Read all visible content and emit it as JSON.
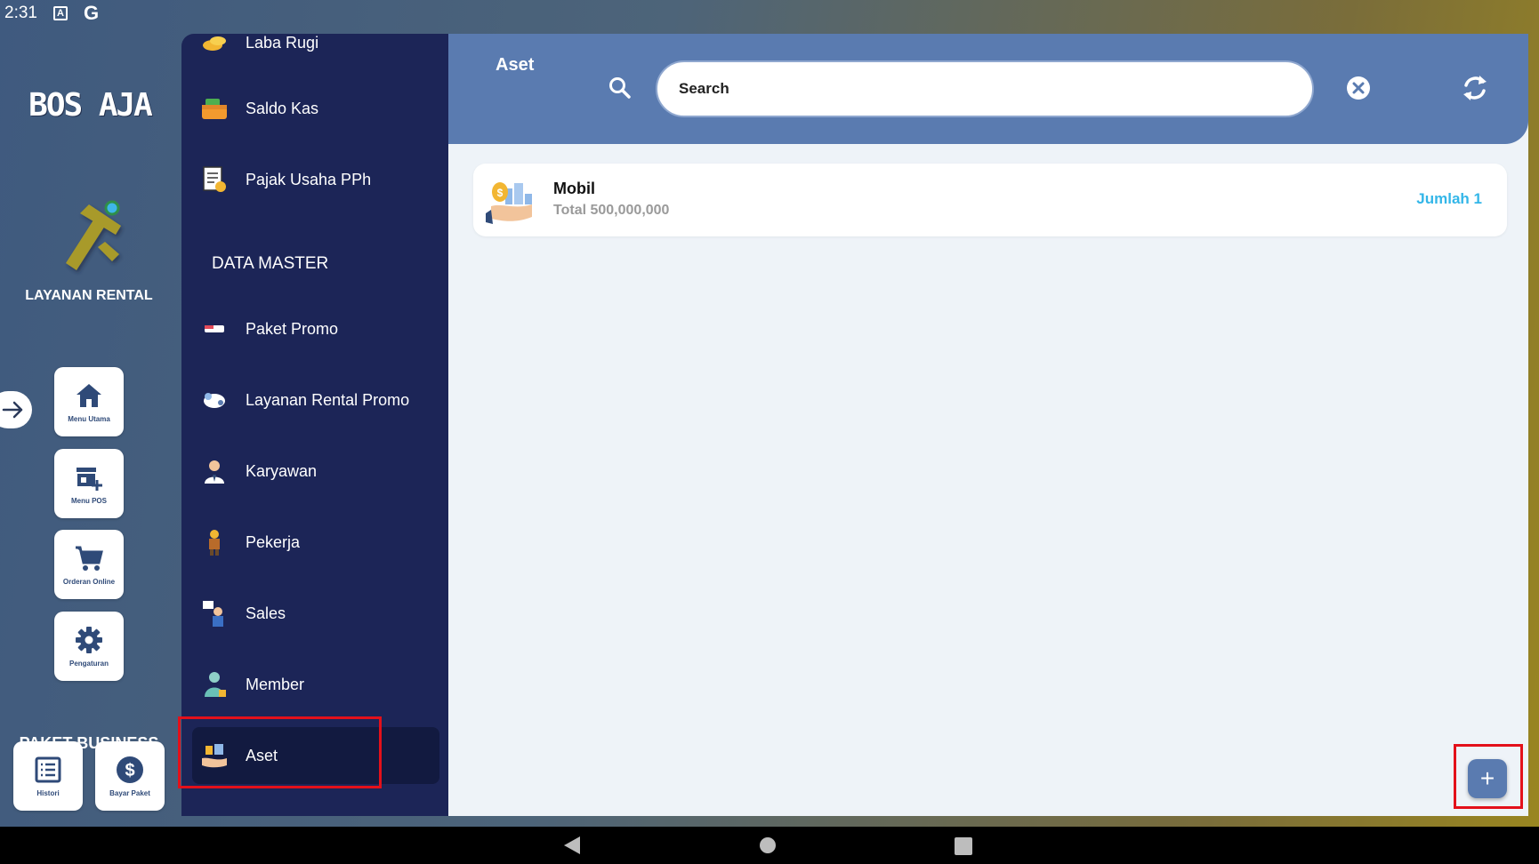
{
  "status_bar": {
    "time": "2:31",
    "icons": [
      "a-icon",
      "google-icon"
    ]
  },
  "rail": {
    "logo_text": "BOS AJA",
    "title": "LAYANAN RENTAL",
    "tiles": [
      {
        "label": "Menu Utama",
        "icon": "home-icon"
      },
      {
        "label": "Menu POS",
        "icon": "pos-store-icon"
      },
      {
        "label": "Orderan Online",
        "icon": "cart-icon"
      },
      {
        "label": "Pengaturan",
        "icon": "gear-icon"
      }
    ],
    "plan_title": "PAKET BUSINESS",
    "plan_tiles": [
      {
        "label": "Histori",
        "icon": "list-icon"
      },
      {
        "label": "Bayar Paket",
        "icon": "dollar-icon"
      }
    ]
  },
  "menu": {
    "items_top": [
      "Laba Rugi",
      "Saldo Kas",
      "Pajak Usaha PPh"
    ],
    "section_header": "DATA MASTER",
    "items_master": [
      "Paket Promo",
      "Layanan Rental Promo",
      "Karyawan",
      "Pekerja",
      "Sales",
      "Member",
      "Aset"
    ],
    "active": "Aset"
  },
  "header": {
    "title": "Aset",
    "search_placeholder": "Search"
  },
  "assets": [
    {
      "name": "Mobil",
      "total": "Total 500,000,000",
      "count": "Jumlah 1"
    }
  ],
  "fab": {
    "label": "+"
  },
  "colors": {
    "header": "#5a7bb0",
    "menu_bg": "#1c2557",
    "accent": "#33b6e8",
    "highlight": "#e3101a"
  }
}
